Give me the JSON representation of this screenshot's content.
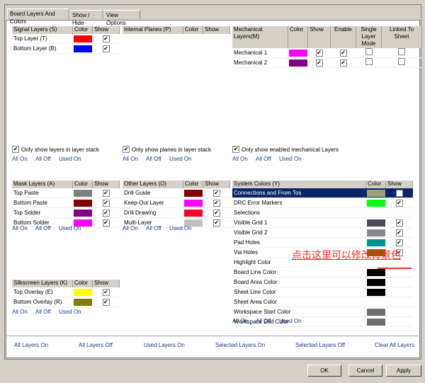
{
  "tabs": [
    "Board Layers And Colors",
    "Show / Hide",
    "View Options"
  ],
  "col": {
    "color": "Color",
    "show": "Show",
    "enable": "Enable",
    "single": "Single Layer Mode",
    "linked": "Linked To Sheet"
  },
  "links": {
    "all_on": "All On",
    "all_off": "All Off",
    "used_on": "Used On"
  },
  "signal": {
    "title": "Signal Layers (S)",
    "rows": [
      {
        "name": "Top Layer (T)",
        "color": "#ff0000",
        "show": true
      },
      {
        "name": "Bottom Layer (B)",
        "color": "#0000ff",
        "show": true
      }
    ],
    "option": "Only show layers in layer stack"
  },
  "planes": {
    "title": "Internal Planes (P)",
    "option": "Only show planes in layer stack"
  },
  "mech": {
    "title": "Mechanical Layers(M)",
    "rows": [
      {
        "name": "Mechanical 1",
        "color": "#ff00ff",
        "show": true,
        "enable": true,
        "single": false,
        "linked": false
      },
      {
        "name": "Mechanical 2",
        "color": "#800080",
        "show": true,
        "enable": true,
        "single": false,
        "linked": false
      }
    ],
    "option": "Only show enabled mechanical Layers"
  },
  "mask": {
    "title": "Mask Layers (A)",
    "rows": [
      {
        "name": "Top Paste",
        "color": "#808080",
        "show": true
      },
      {
        "name": "Bottom Paste",
        "color": "#800000",
        "show": true
      },
      {
        "name": "Top Solder",
        "color": "#800080",
        "show": true
      },
      {
        "name": "Bottom Solder",
        "color": "#ff00ff",
        "show": true
      }
    ]
  },
  "other": {
    "title": "Other Layers (O)",
    "rows": [
      {
        "name": "Drill Guide",
        "color": "#800000",
        "show": true
      },
      {
        "name": "Keep-Out Layer",
        "color": "#ff00ff",
        "show": true
      },
      {
        "name": "Drill Drawing",
        "color": "#ff002a",
        "show": true
      },
      {
        "name": "Multi-Layer",
        "color": "#c0c0c0",
        "show": true
      }
    ]
  },
  "silk": {
    "title": "Silkscreen Layers (K)",
    "rows": [
      {
        "name": "Top Overlay (E)",
        "color": "#ffff00",
        "show": true
      },
      {
        "name": "Bottom Overlay (R)",
        "color": "#808000",
        "show": true
      }
    ]
  },
  "system": {
    "title": "System Colors (Y)",
    "rows": [
      {
        "name": "Connections and From Tos",
        "color": "#a0a078",
        "show": true
      },
      {
        "name": "DRC Error Markers",
        "color": "#00ff00",
        "show": true
      },
      {
        "name": "Selections",
        "color": "#ffffff",
        "show": null
      },
      {
        "name": "Visible Grid 1",
        "color": "#4a4a5a",
        "show": true
      },
      {
        "name": "Visible Grid 2",
        "color": "#8a8890",
        "show": true
      },
      {
        "name": "Pad Holes",
        "color": "#009090",
        "show": true
      },
      {
        "name": "Via Holes",
        "color": "#806000",
        "show": true
      },
      {
        "name": "Highlight Color",
        "color": "#ffffff",
        "show": null
      },
      {
        "name": "Board Line Color",
        "color": "#000000",
        "show": null
      },
      {
        "name": "Board Area Color",
        "color": "#000000",
        "show": null
      },
      {
        "name": "Sheet Line Color",
        "color": "#000000",
        "show": null
      },
      {
        "name": "Sheet Area Color",
        "color": "#ffffff",
        "show": null
      },
      {
        "name": "Workspace Start Color",
        "color": "#6e6e6e",
        "show": null
      },
      {
        "name": "Workspace End Color",
        "color": "#6e6e6e",
        "show": null
      }
    ]
  },
  "bottom_links": [
    "All Layers On",
    "All Layers Off",
    "Used Layers On",
    "Selected Layers On",
    "Selected Layers Off",
    "Clear All Layers"
  ],
  "buttons": {
    "ok": "OK",
    "cancel": "Cancel",
    "apply": "Apply"
  },
  "annotation": "点击这里可以修改背景色"
}
